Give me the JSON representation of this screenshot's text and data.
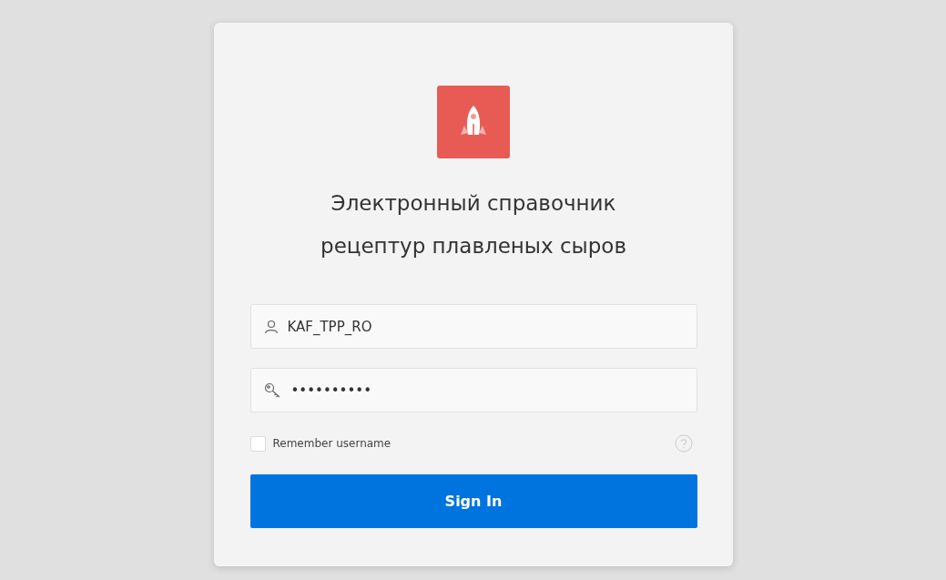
{
  "logo": {
    "kind": "rocket"
  },
  "title": "Электронный справочник рецептур плавленых сыров",
  "username": {
    "value": "KAF_TPP_RO"
  },
  "password": {
    "value": "••••••••••"
  },
  "remember": {
    "label": "Remember username",
    "checked": false
  },
  "sign_in": {
    "label": "Sign In"
  }
}
